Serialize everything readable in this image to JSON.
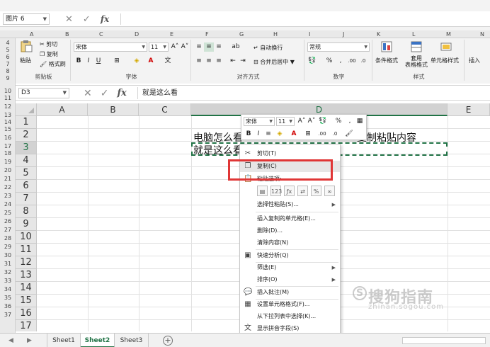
{
  "outer": {
    "namebox": "图片 6",
    "col_letters": [
      "A",
      "B",
      "C",
      "D",
      "E",
      "F",
      "G",
      "H",
      "I",
      "J",
      "K",
      "L",
      "M",
      "N"
    ],
    "row_numbers": [
      "4",
      "5",
      "6",
      "7",
      "8",
      "9",
      "10",
      "11",
      "12",
      "13"
    ],
    "clipboard": {
      "paste": "粘贴",
      "cut": "剪切",
      "copy": "复制",
      "format_painter": "格式刷",
      "label": "剪贴板"
    },
    "font": {
      "name": "宋体",
      "size": "11",
      "label": "字体",
      "bold": "B",
      "italic": "I",
      "underline": "U"
    },
    "alignment": {
      "wrap": "自动换行",
      "merge": "合并后居中",
      "label": "对齐方式"
    },
    "number": {
      "format": "常规",
      "percent": "%",
      "comma": ",",
      "label": "数字"
    },
    "styles": {
      "conditional": "条件格式",
      "table_format": "套用\n表格格式",
      "cell_style": "单元格样式",
      "label": "样式"
    },
    "insert": "插入"
  },
  "sheet": {
    "namebox": "D3",
    "formula": "就是这么看",
    "columns": [
      "A",
      "B",
      "C",
      "D",
      "E"
    ],
    "rows": [
      "1",
      "2",
      "3",
      "4",
      "5",
      "6",
      "7",
      "8",
      "9",
      "10",
      "11",
      "12",
      "13",
      "14",
      "15",
      "16",
      "17"
    ],
    "cell_d2_left": "电脑怎么看",
    "cell_d2_right": "复制粘贴内容",
    "cell_d3": "就是这么看",
    "small_rows": [
      "9",
      "10",
      "11",
      "12",
      "13",
      "14",
      "15",
      "16",
      "17",
      "18",
      "19",
      "20",
      "21",
      "22",
      "23",
      "24",
      "25",
      "26",
      "27",
      "28",
      "29",
      "30",
      "31",
      "32",
      "33",
      "34",
      "35",
      "36",
      "37"
    ]
  },
  "mini_toolbar": {
    "font": "宋体",
    "size": "11",
    "percent": "%",
    "comma": ","
  },
  "context_menu": {
    "cut": "剪切(T)",
    "copy": "复制(C)",
    "paste_options": "粘贴选项:",
    "paste_special": "选择性粘贴(S)...",
    "insert_copied": "插入复制的单元格(E)...",
    "delete": "删除(D)...",
    "clear": "清除内容(N)",
    "quick_analysis": "快速分析(Q)",
    "filter": "筛选(E)",
    "sort": "排序(O)",
    "insert_comment": "插入批注(M)",
    "format_cells": "设置单元格格式(F)...",
    "pick_list": "从下拉列表中选择(K)...",
    "phonetic": "显示拼音字段(S)"
  },
  "tabs": {
    "sheets": [
      "Sheet1",
      "Sheet2",
      "Sheet3"
    ],
    "active": "Sheet2",
    "add": "+"
  },
  "watermark": {
    "text": "搜狗指南",
    "sub": "zhinan.sogou.com",
    "logo": "S"
  },
  "colors": {
    "accent": "#217346",
    "highlight_box": "#e03636"
  }
}
